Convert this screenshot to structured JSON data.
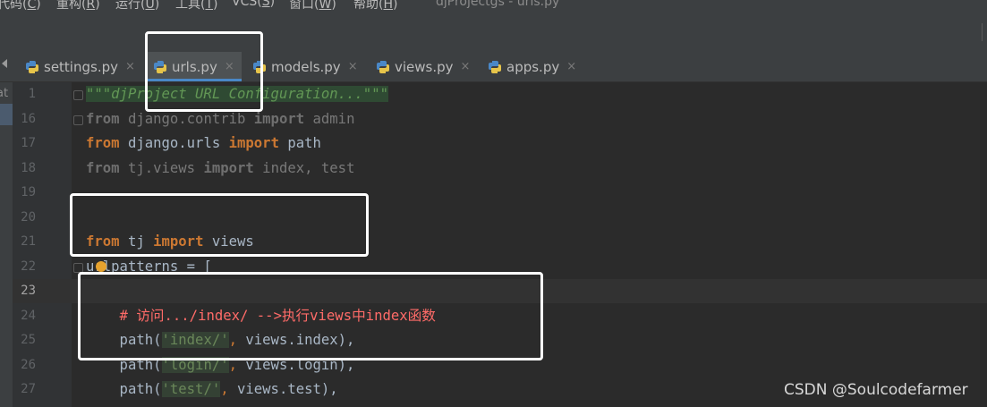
{
  "menubar": {
    "items": [
      {
        "label": "代码(",
        "key": "C",
        "suffix": ")"
      },
      {
        "label": "重构(",
        "key": "R",
        "suffix": ")"
      },
      {
        "label": "运行(",
        "key": "U",
        "suffix": ")"
      },
      {
        "label": "工具(",
        "key": "T",
        "suffix": ")"
      },
      {
        "label": "VCS(",
        "key": "S",
        "suffix": ")"
      },
      {
        "label": "窗口(",
        "key": "W",
        "suffix": ")"
      },
      {
        "label": "帮助(",
        "key": "H",
        "suffix": ")"
      }
    ],
    "window_title": "djProjectgs - urls.py"
  },
  "tabs": [
    {
      "label": "settings.py",
      "icon": "python-file-icon",
      "active": false
    },
    {
      "label": "urls.py",
      "icon": "python-file-icon",
      "active": true
    },
    {
      "label": "models.py",
      "icon": "python-file-icon",
      "active": false
    },
    {
      "label": "views.py",
      "icon": "python-file-icon",
      "active": false
    },
    {
      "label": "apps.py",
      "icon": "python-file-icon",
      "active": false
    }
  ],
  "tab_close_glyph": "×",
  "left_strip_label": "at",
  "editor": {
    "current_line": "23",
    "lines": [
      {
        "num": "1",
        "t": [
          {
            "s": "\"\"\"djProject URL Configuration...\"\"\"",
            "c": "docstr"
          }
        ]
      },
      {
        "num": "16",
        "t": [
          {
            "s": "from",
            "c": "kw-dim"
          },
          {
            "s": " django.contrib ",
            "c": "dim"
          },
          {
            "s": "import",
            "c": "kw-dim"
          },
          {
            "s": " admin",
            "c": "dim"
          }
        ]
      },
      {
        "num": "17",
        "t": [
          {
            "s": "from",
            "c": "kw"
          },
          {
            "s": " django.urls ",
            "c": "ident"
          },
          {
            "s": "import",
            "c": "kw"
          },
          {
            "s": " path",
            "c": "ident"
          }
        ]
      },
      {
        "num": "18",
        "t": [
          {
            "s": "from",
            "c": "kw-dim"
          },
          {
            "s": " tj.views ",
            "c": "dim"
          },
          {
            "s": "import",
            "c": "kw-dim"
          },
          {
            "s": " index, test",
            "c": "dim"
          }
        ]
      },
      {
        "num": "19",
        "t": []
      },
      {
        "num": "20",
        "t": []
      },
      {
        "num": "21",
        "t": [
          {
            "s": "from",
            "c": "kw"
          },
          {
            "s": " tj ",
            "c": "ident"
          },
          {
            "s": "import",
            "c": "kw"
          },
          {
            "s": " views",
            "c": "ident"
          }
        ]
      },
      {
        "num": "22",
        "t": [
          {
            "s": "urlpatterns = [",
            "c": "ident"
          }
        ]
      },
      {
        "num": "23",
        "t": []
      },
      {
        "num": "24",
        "t": [
          {
            "s": "    # 访问.../index/ -->执行views中index函数",
            "c": "comment-red"
          }
        ]
      },
      {
        "num": "25",
        "t": [
          {
            "s": "    path(",
            "c": "ident"
          },
          {
            "s": "'index/'",
            "c": "str-hl"
          },
          {
            "s": ", ",
            "c": "punct"
          },
          {
            "s": "views.index),",
            "c": "ident"
          }
        ]
      },
      {
        "num": "26",
        "t": [
          {
            "s": "    path(",
            "c": "ident"
          },
          {
            "s": "'login/'",
            "c": "str-hl"
          },
          {
            "s": ", ",
            "c": "punct"
          },
          {
            "s": "views.login),",
            "c": "ident"
          }
        ]
      },
      {
        "num": "27",
        "t": [
          {
            "s": "    path(",
            "c": "ident"
          },
          {
            "s": "'test/'",
            "c": "str-hl"
          },
          {
            "s": ", ",
            "c": "punct"
          },
          {
            "s": "views.test),",
            "c": "ident"
          }
        ]
      }
    ]
  },
  "watermark": "CSDN @Soulcodefarmer",
  "colors": {
    "annotation_box": "#ffffff",
    "active_tab_underline": "#4a88c7",
    "keyword": "#cc7832",
    "string": "#6a8759",
    "comment": "#ff6b68"
  }
}
